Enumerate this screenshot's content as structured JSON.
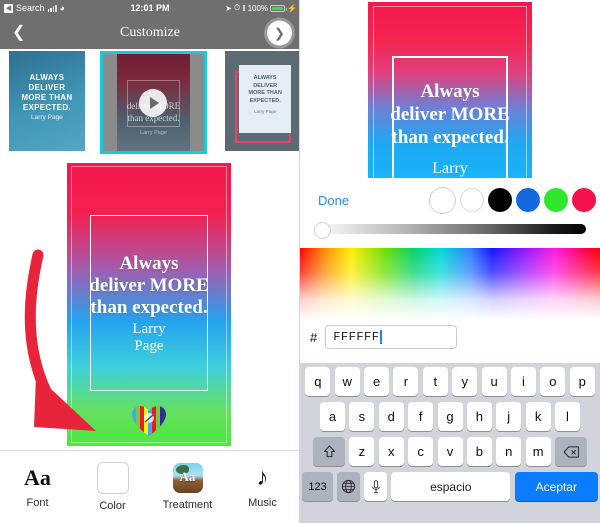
{
  "status_bar": {
    "back_label": "Search",
    "time": "12:01 PM",
    "battery_percent": "100%",
    "icons": [
      "back-arrow-icon",
      "cellular-signal-icon",
      "wifi-icon",
      "location-arrow-icon",
      "alarm-clock-icon",
      "bluetooth-icon",
      "battery-icon",
      "charging-bolt-icon"
    ]
  },
  "nav": {
    "title": "Customize",
    "back_icon": "chevron-left-icon",
    "next_icon": "chevron-right-icon"
  },
  "thumbnails": [
    {
      "quote": "ALWAYS\nDELIVER\nMORE THAN\nEXPECTED.",
      "author": "Larry Page",
      "selected": false,
      "has_play": false
    },
    {
      "quote": "deliver MORE\nthan expected.",
      "author": "Larry Page",
      "selected": true,
      "has_play": true
    },
    {
      "quote": "ALWAYS\nDELIVER\nMORE THAN\nEXPECTED.",
      "author": "Larry Page",
      "selected": false,
      "has_play": false
    }
  ],
  "main_card": {
    "quote": "Always\ndeliver MORE\nthan expected.",
    "author": "Larry\nPage",
    "gradient_top": "#F5174E",
    "gradient_mid": "#23A3EF",
    "gradient_bottom": "#4BE83D",
    "logo": "striped-heart-logo"
  },
  "annotation": {
    "arrow_color": "#E8243B",
    "arrow_name": "red-annotation-arrow"
  },
  "toolbar": {
    "items": [
      {
        "label": "Font",
        "icon": "font-aa-icon"
      },
      {
        "label": "Color",
        "icon": "color-swatch-icon"
      },
      {
        "label": "Treatment",
        "icon": "treatment-image-icon"
      },
      {
        "label": "Music",
        "icon": "music-note-icon"
      }
    ]
  },
  "color_panel": {
    "preview": {
      "quote": "Always\ndeliver MORE\nthan expected.",
      "author": "Larry",
      "gradient_top": "#F5174E",
      "gradient_bottom": "#19B4F7"
    },
    "done_label": "Done",
    "swatches": [
      {
        "name": "swatch-white-selected",
        "color": "#FFFFFF",
        "selected": true
      },
      {
        "name": "swatch-white",
        "color": "#FFFFFF",
        "selected": false
      },
      {
        "name": "swatch-black",
        "color": "#000000",
        "selected": false
      },
      {
        "name": "swatch-blue",
        "color": "#1569E0",
        "selected": false
      },
      {
        "name": "swatch-green",
        "color": "#2EE62E",
        "selected": false
      },
      {
        "name": "swatch-red",
        "color": "#F5114C",
        "selected": false
      }
    ],
    "brightness_slider": {
      "name": "brightness-slider",
      "value": 0
    },
    "hex_prefix": "#",
    "hex_value": "FFFFFF"
  },
  "keyboard": {
    "row1": [
      "q",
      "w",
      "e",
      "r",
      "t",
      "y",
      "u",
      "i",
      "o",
      "p"
    ],
    "row2": [
      "a",
      "s",
      "d",
      "f",
      "g",
      "h",
      "j",
      "k",
      "l"
    ],
    "row3": [
      "z",
      "x",
      "c",
      "v",
      "b",
      "n",
      "m"
    ],
    "shift_icon": "shift-arrow-icon",
    "delete_icon": "backspace-icon",
    "numbers_label": "123",
    "globe_icon": "globe-icon",
    "mic_icon": "microphone-icon",
    "space_label": "espacio",
    "accept_label": "Aceptar"
  }
}
